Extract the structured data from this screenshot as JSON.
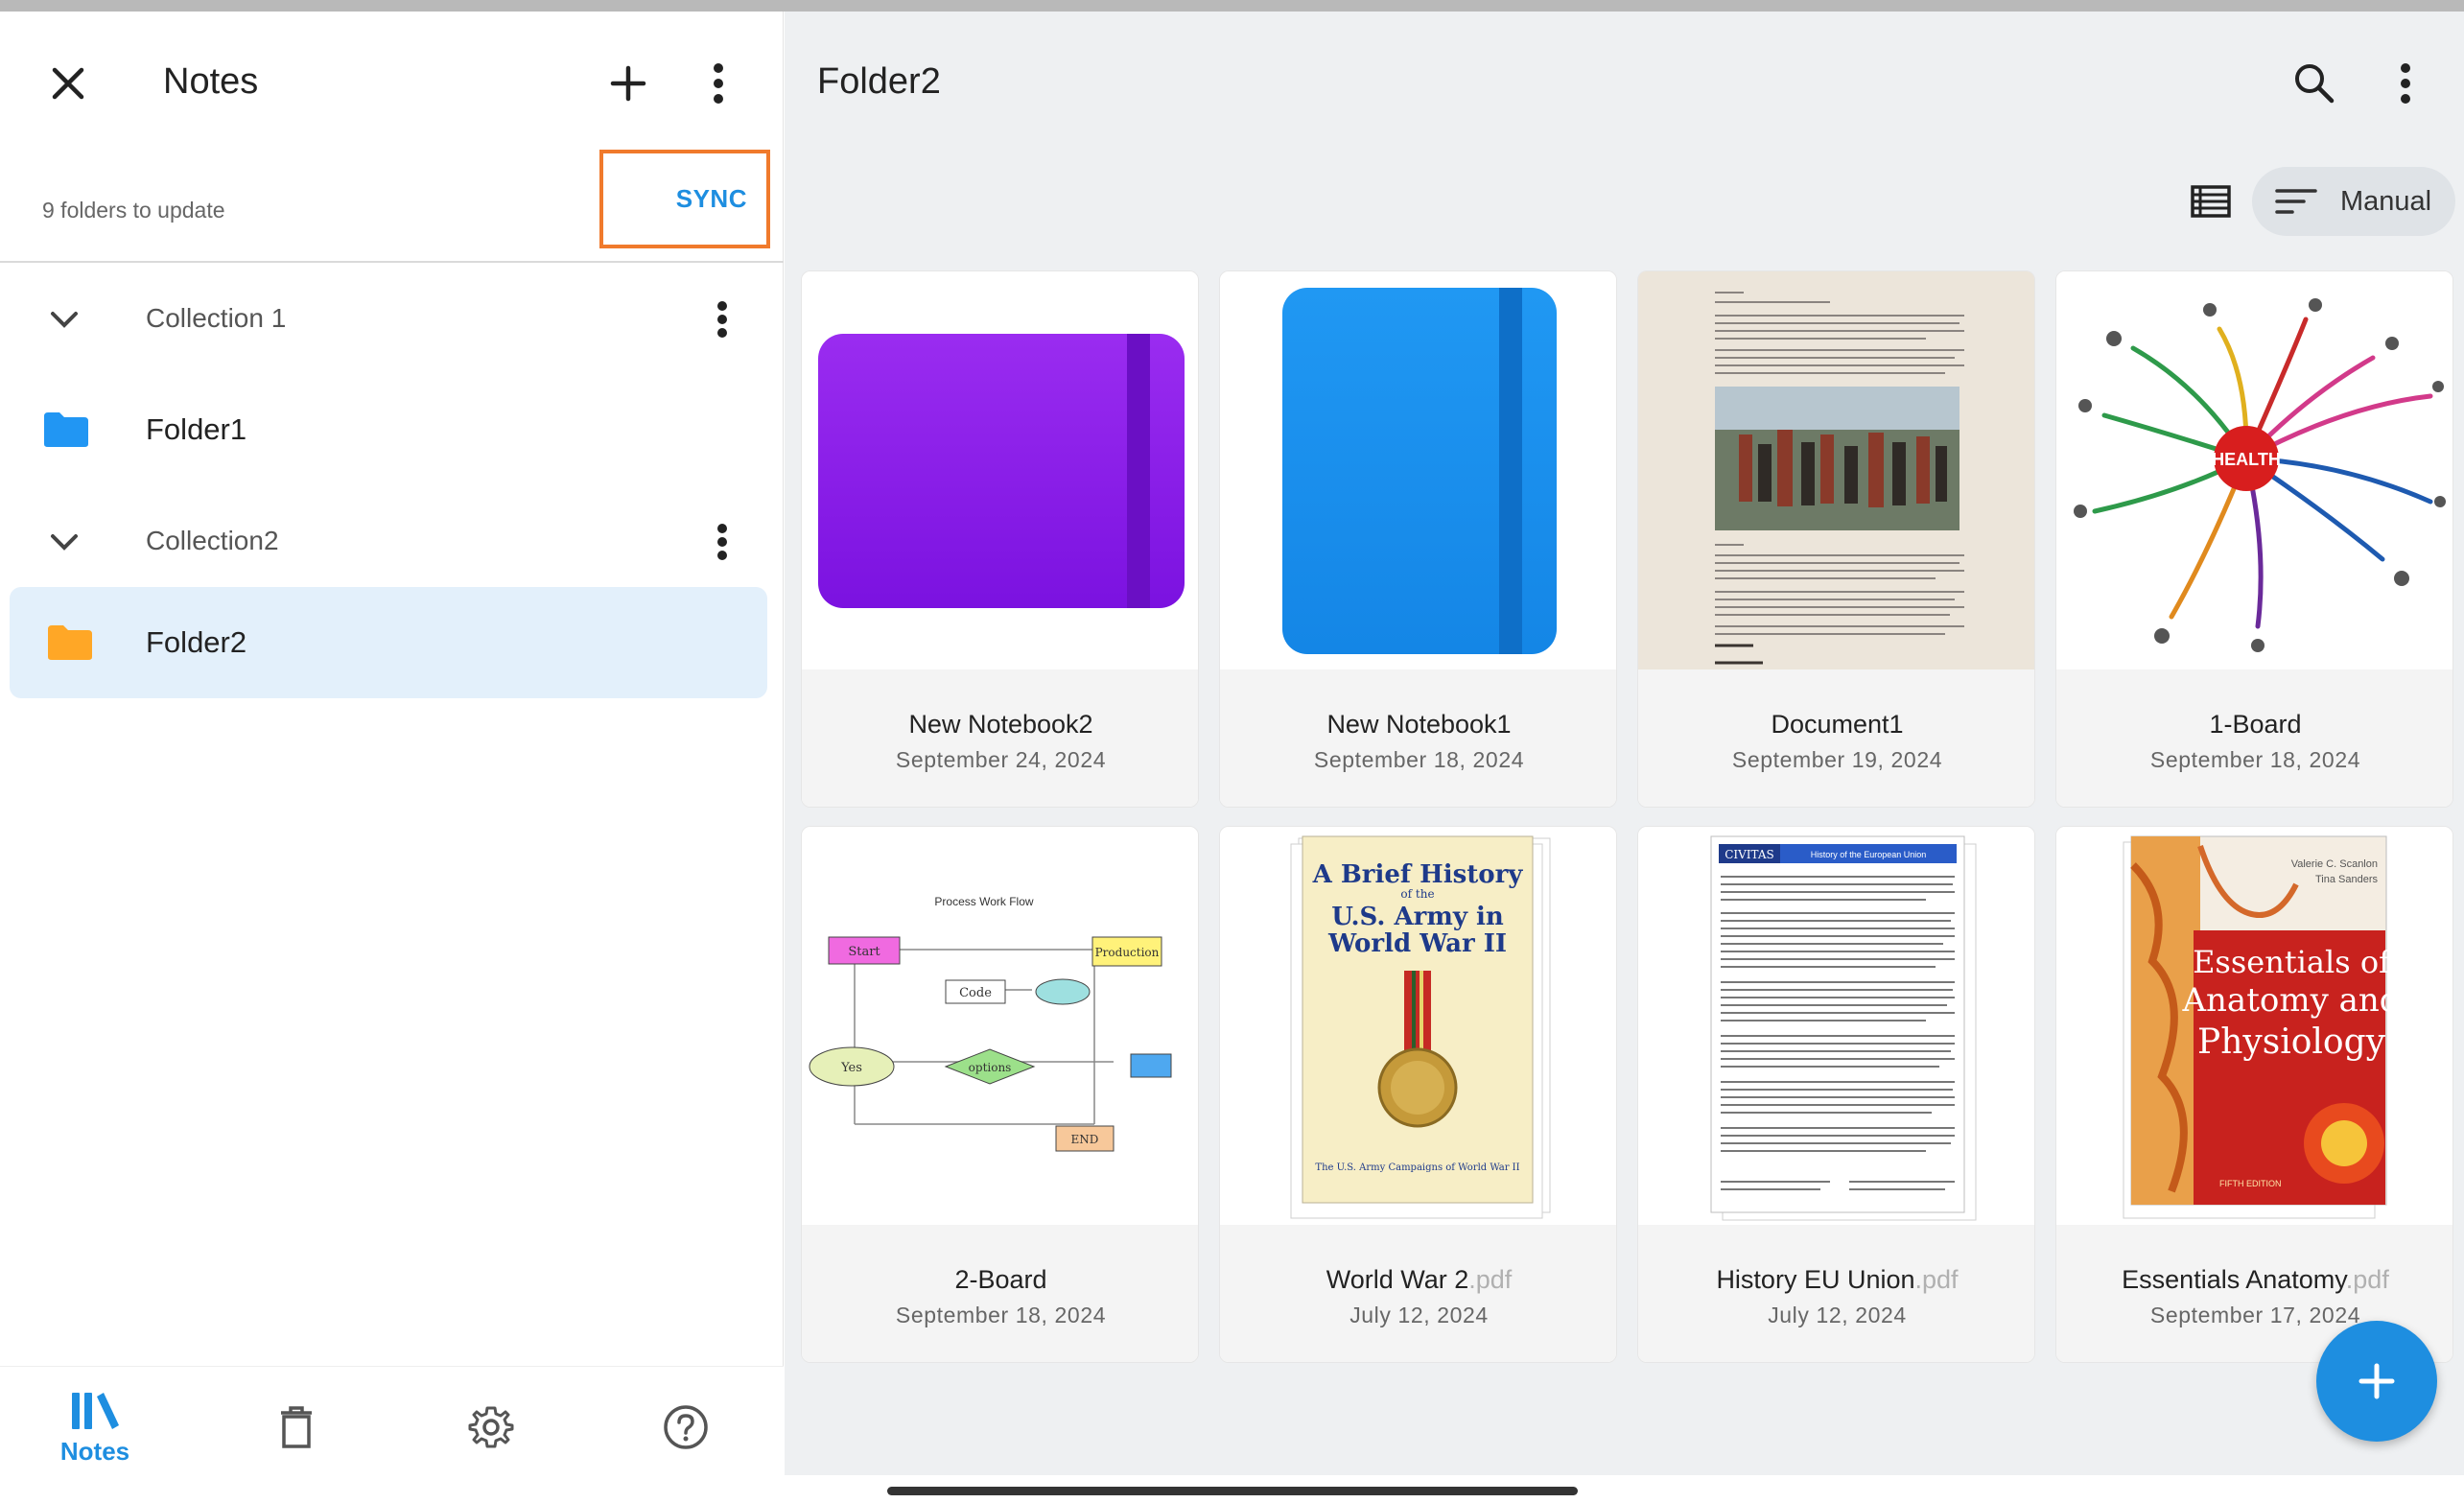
{
  "sidebar": {
    "title": "Notes",
    "sync_status": "9 folders to update",
    "sync_label": "SYNC",
    "tree": [
      {
        "type": "collection",
        "label": "Collection 1"
      },
      {
        "type": "folder",
        "label": "Folder1",
        "color": "#2196f3"
      },
      {
        "type": "collection",
        "label": "Collection2"
      },
      {
        "type": "folder",
        "label": "Folder2",
        "color": "#ffa726",
        "selected": true
      }
    ],
    "bottom_nav": [
      {
        "icon": "library-icon",
        "label": "Notes",
        "active": true
      },
      {
        "icon": "trash-icon",
        "label": ""
      },
      {
        "icon": "gear-icon",
        "label": ""
      },
      {
        "icon": "help-icon",
        "label": ""
      }
    ]
  },
  "main": {
    "title": "Folder2",
    "sort_label": "Manual",
    "items": [
      {
        "name": "New Notebook2",
        "ext": "",
        "date": "September 24, 2024",
        "thumb": "notebook-purple"
      },
      {
        "name": "New Notebook1",
        "ext": "",
        "date": "September 18, 2024",
        "thumb": "notebook-blue"
      },
      {
        "name": "Document1",
        "ext": "",
        "date": "September 19, 2024",
        "thumb": "document"
      },
      {
        "name": "1-Board",
        "ext": "",
        "date": "September 18, 2024",
        "thumb": "mindmap"
      },
      {
        "name": "2-Board",
        "ext": "",
        "date": "September 18, 2024",
        "thumb": "flowchart"
      },
      {
        "name": "World War 2",
        "ext": ".pdf",
        "date": "July 12, 2024",
        "thumb": "book-ww2"
      },
      {
        "name": "History EU Union",
        "ext": ".pdf",
        "date": "July 12, 2024",
        "thumb": "doc-eu"
      },
      {
        "name": "Essentials Anatomy",
        "ext": ".pdf",
        "date": "September 17, 2024",
        "thumb": "book-anatomy"
      }
    ],
    "thumb_text": {
      "flow_title": "Process Work Flow",
      "flow_start": "Start",
      "flow_code": "Code",
      "flow_production": "Production",
      "flow_yes": "Yes",
      "flow_options": "options",
      "flow_end": "END",
      "ww2_title_1": "A Brief History",
      "ww2_title_2": "of the",
      "ww2_title_3": "U.S. Army in",
      "ww2_title_4": "World War II",
      "ww2_subtitle": "The U.S. Army Campaigns of World War II",
      "eu_brand": "CIVITAS",
      "eu_header": "History of the European Union",
      "anatomy_authors_1": "Valerie C. Scanlon",
      "anatomy_authors_2": "Tina Sanders",
      "anatomy_title_1": "Essentials of",
      "anatomy_title_2": "Anatomy and",
      "anatomy_title_3": "Physiology",
      "anatomy_edition": "FIFTH EDITION",
      "mindmap_center": "HEALTH"
    }
  },
  "colors": {
    "accent": "#1e8ee0",
    "sync_highlight": "#f07a2c",
    "selected_bg": "#e3f0fb",
    "notebook_purple": "#8a1ee6",
    "notebook_blue": "#1e90ee"
  }
}
